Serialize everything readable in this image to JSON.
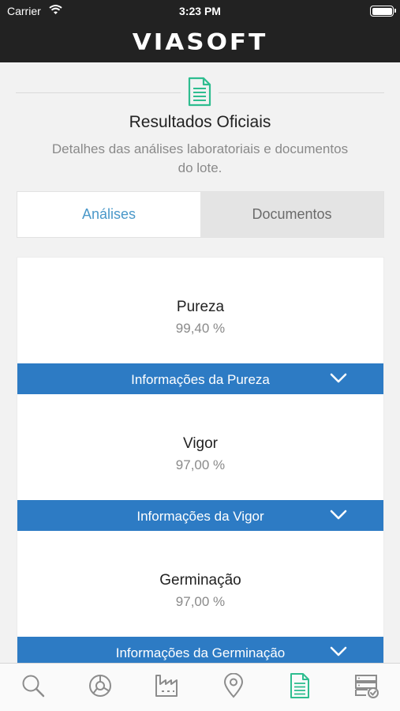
{
  "status_bar": {
    "carrier": "Carrier",
    "time": "3:23 PM"
  },
  "brand": {
    "logo_text": "VIASOFT"
  },
  "section": {
    "title": "Resultados Oficiais",
    "subtitle": "Detalhes das análises laboratoriais e documentos do lote.",
    "icon": "document-icon"
  },
  "tabs": [
    {
      "label": "Análises",
      "active": true
    },
    {
      "label": "Documentos",
      "active": false
    }
  ],
  "analyses": [
    {
      "name": "Pureza",
      "value": "99,40 %",
      "info_label": "Informações da Pureza"
    },
    {
      "name": "Vigor",
      "value": "97,00 %",
      "info_label": "Informações da Vigor"
    },
    {
      "name": "Germinação",
      "value": "97,00 %",
      "info_label": "Informações da Germinação"
    }
  ],
  "bottom_tabs": [
    {
      "icon": "search-icon",
      "active": false
    },
    {
      "icon": "pie-chart-icon",
      "active": false
    },
    {
      "icon": "factory-icon",
      "active": false
    },
    {
      "icon": "location-pin-icon",
      "active": false
    },
    {
      "icon": "document-icon",
      "active": true
    },
    {
      "icon": "server-check-icon",
      "active": false
    }
  ],
  "colors": {
    "header_bg": "#222222",
    "accent_green": "#2ebd8f",
    "tab_active_text": "#4a98c9",
    "info_bar_blue": "#2d7bc4",
    "inactive_icon": "#8c8c8c"
  }
}
